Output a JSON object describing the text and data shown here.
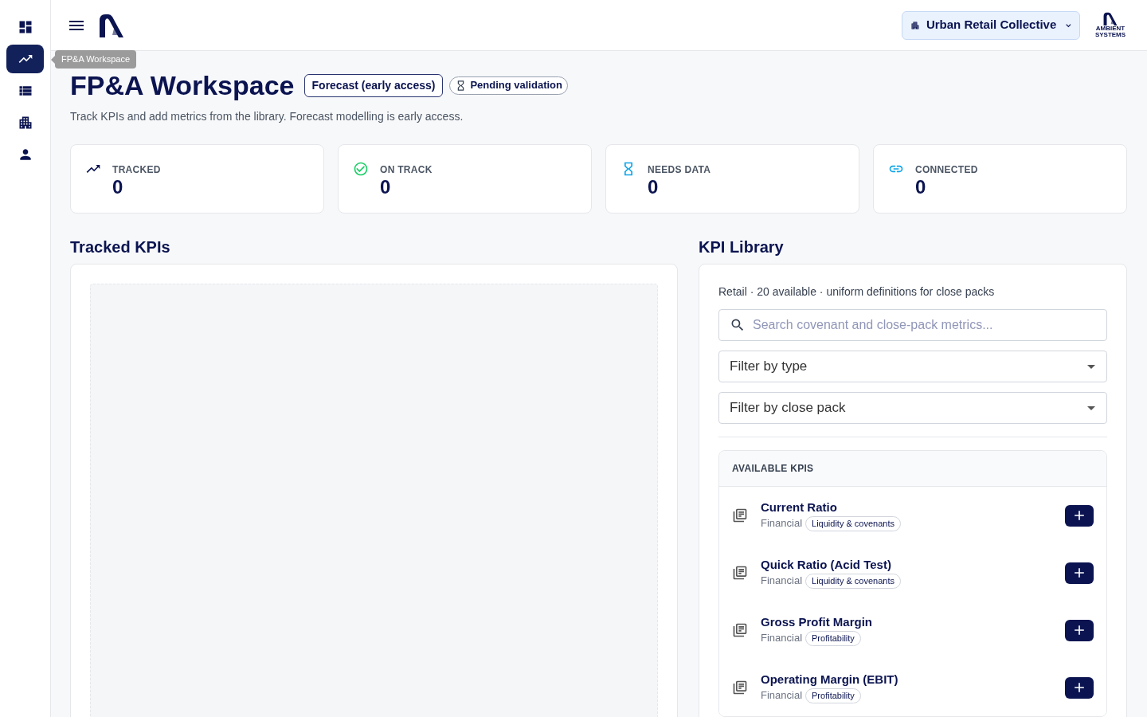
{
  "rail": {
    "items": [
      {
        "selected": false
      },
      {
        "selected": true
      },
      {
        "selected": false
      },
      {
        "selected": false
      },
      {
        "selected": false
      }
    ]
  },
  "tooltip": {
    "text": "FP&A Workspace"
  },
  "topbar": {
    "org_selector": {
      "label": "Urban Retail Collective"
    },
    "logo_text": "AMBIENT SYSTEMS"
  },
  "header": {
    "title": "FP&A Workspace",
    "badges": [
      {
        "label": "Forecast (early access)",
        "kind": "outline"
      },
      {
        "label": "Pending validation",
        "kind": "status"
      }
    ],
    "subtitle": "Track KPIs and add metrics from the library. Forecast modelling is early access."
  },
  "stats": [
    {
      "label": "TRACKED",
      "value": "0",
      "color": "#0b1450"
    },
    {
      "label": "ON TRACK",
      "value": "0",
      "color": "#1fcf6a"
    },
    {
      "label": "NEEDS DATA",
      "value": "0",
      "color": "#0ea5e9"
    },
    {
      "label": "CONNECTED",
      "value": "0",
      "color": "#0ea5e9"
    }
  ],
  "tracked_kpis": {
    "heading": "Tracked KPIs"
  },
  "kpi_library": {
    "heading": "KPI Library",
    "summary": "Retail · 20 available · uniform definitions for close packs",
    "search": {
      "placeholder": "Search covenant and close-pack metrics..."
    },
    "filters": [
      {
        "label": "Filter by type"
      },
      {
        "label": "Filter by close pack"
      }
    ],
    "list_heading": "AVAILABLE KPIS",
    "items": [
      {
        "name": "Current Ratio",
        "type": "Financial",
        "tag": "Liquidity & covenants"
      },
      {
        "name": "Quick Ratio (Acid Test)",
        "type": "Financial",
        "tag": "Liquidity & covenants"
      },
      {
        "name": "Gross Profit Margin",
        "type": "Financial",
        "tag": "Profitability"
      },
      {
        "name": "Operating Margin (EBIT)",
        "type": "Financial",
        "tag": "Profitability"
      }
    ]
  }
}
